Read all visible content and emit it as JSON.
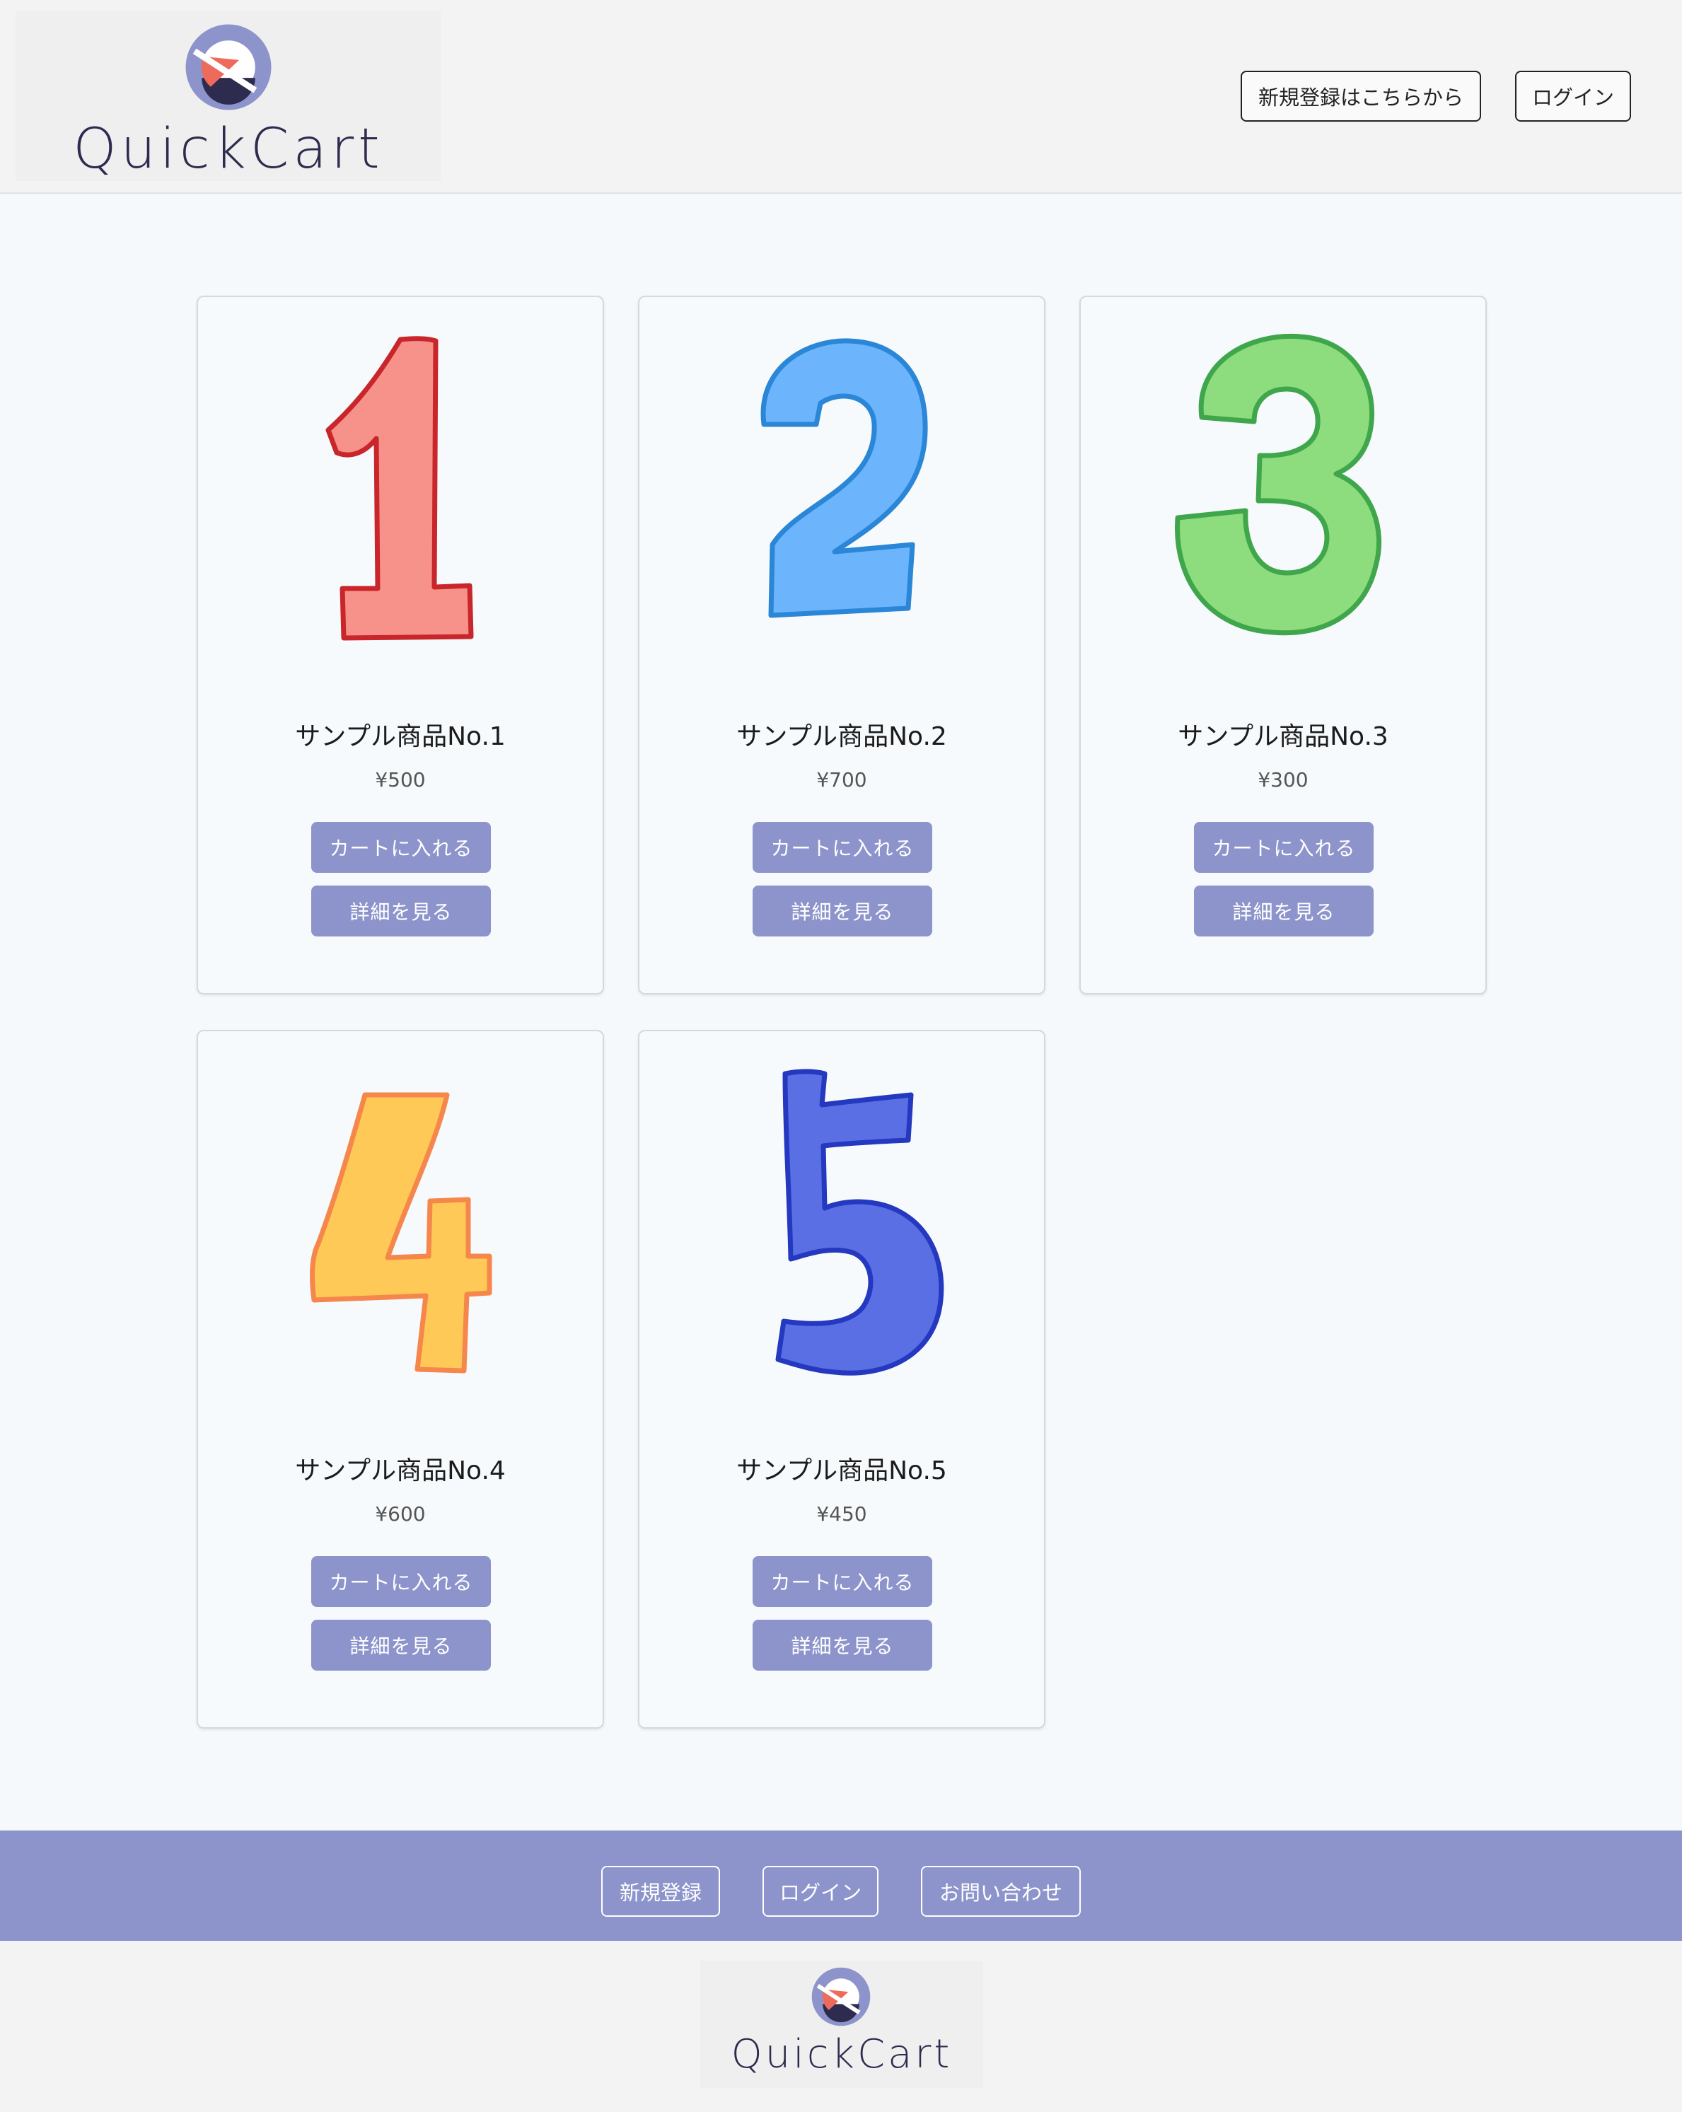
{
  "header": {
    "logo_text": "QuickCart",
    "signup_label": "新規登録はこちらから",
    "login_label": "ログイン"
  },
  "products": [
    {
      "name": "サンプル商品No.1",
      "price": "¥500",
      "cart_label": "カートに入れる",
      "detail_label": "詳細を見る",
      "digit": "1",
      "fill": "#f7928a",
      "stroke": "#c8262a"
    },
    {
      "name": "サンプル商品No.2",
      "price": "¥700",
      "cart_label": "カートに入れる",
      "detail_label": "詳細を見る",
      "digit": "2",
      "fill": "#6cb4fb",
      "stroke": "#2a86d6"
    },
    {
      "name": "サンプル商品No.3",
      "price": "¥300",
      "cart_label": "カートに入れる",
      "detail_label": "詳細を見る",
      "digit": "3",
      "fill": "#8ddc7e",
      "stroke": "#3fa64b"
    },
    {
      "name": "サンプル商品No.4",
      "price": "¥600",
      "cart_label": "カートに入れる",
      "detail_label": "詳細を見る",
      "digit": "4",
      "fill": "#fec956",
      "stroke": "#f6874c"
    },
    {
      "name": "サンプル商品No.5",
      "price": "¥450",
      "cart_label": "カートに入れる",
      "detail_label": "詳細を見る",
      "digit": "5",
      "fill": "#5a6fe4",
      "stroke": "#2438c0"
    }
  ],
  "footer": {
    "signup_label": "新規登録",
    "login_label": "ログイン",
    "contact_label": "お問い合わせ",
    "logo_text": "QuickCart"
  },
  "colors": {
    "accent": "#8c94cb",
    "logo_dark": "#2d2b4e",
    "logo_red": "#ee6a5a",
    "logo_light": "#8c94cb"
  }
}
